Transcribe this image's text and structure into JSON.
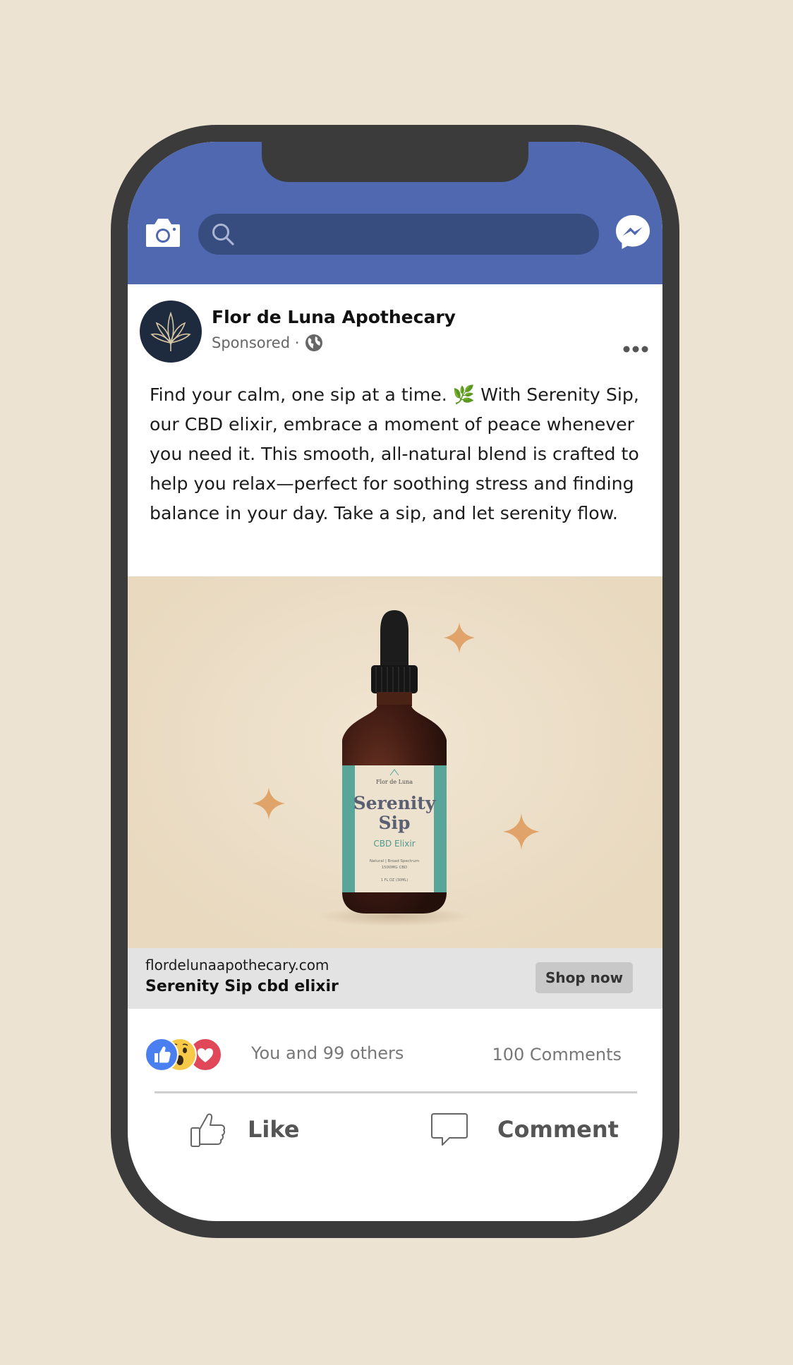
{
  "search": {
    "placeholder": ""
  },
  "post": {
    "page_name": "Flor de Luna Apothecary",
    "sponsored": "Sponsored ·",
    "text": "Find your calm, one sip at a time. 🌿 With Serenity Sip, our CBD elixir, embrace a moment of peace whenever you need it. This smooth, all-natural blend is crafted to help you relax—perfect for soothing stress and finding balance in your day. Take a sip, and let serenity flow."
  },
  "product": {
    "brand": "Flor de Luna",
    "name_line1": "Serenity",
    "name_line2": "Sip",
    "subtitle": "CBD Elixir",
    "detail1": "Natural | Broad Spectrum",
    "detail2": "1500MG CBD",
    "volume": "1 FL OZ (30ML)"
  },
  "link": {
    "domain": "flordelunaapothecary.com",
    "title": "Serenity Sip cbd elixir",
    "cta": "Shop now"
  },
  "engagement": {
    "reactions": "You and 99 others",
    "comments": "100 Comments",
    "reaction_icons": [
      "like-icon",
      "wow-icon",
      "love-icon"
    ]
  },
  "actions": {
    "like": "Like",
    "comment": "Comment"
  },
  "colors": {
    "background": "#ece3d2",
    "facebook_blue": "#4f68b0",
    "search_bar": "#374d80",
    "phone_frame": "#3b3b3b",
    "sparkle": "#e0a46a",
    "label_teal": "#5aa59a"
  }
}
